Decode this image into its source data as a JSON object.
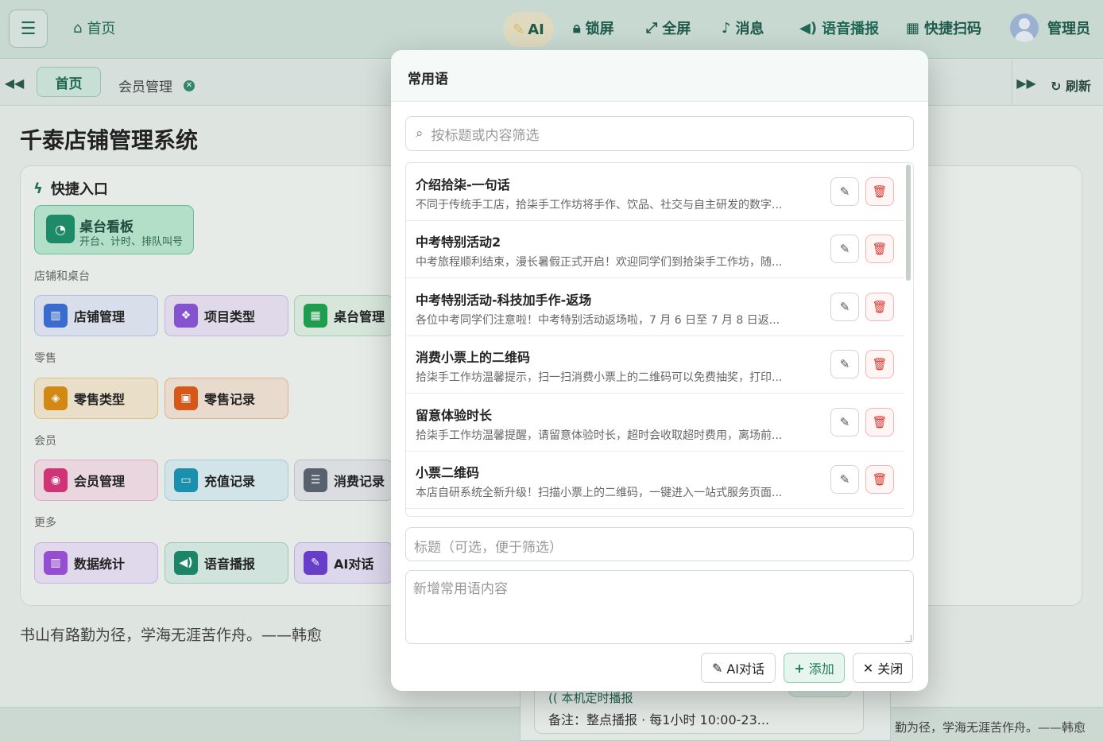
{
  "topbar": {
    "home": "首页",
    "ai": "AI",
    "lock": "锁屏",
    "fullscreen": "全屏",
    "messages": "消息",
    "voice": "语音播报",
    "scan": "快捷扫码",
    "user": "管理员"
  },
  "tabs": {
    "home": "首页",
    "member": "会员管理",
    "refresh": "刷新"
  },
  "page": {
    "title": "千泰店铺管理系统",
    "quick_entry": "快捷入口",
    "board_title": "桌台看板",
    "board_sub": "开台、计时、排队叫号",
    "sections": [
      "店铺和桌台",
      "零售",
      "会员",
      "更多"
    ],
    "tiles": {
      "shop": "店铺管理",
      "project": "项目类型",
      "table": "桌台管理",
      "retail_type": "零售类型",
      "retail_record": "零售记录",
      "member": "会员管理",
      "recharge": "充值记录",
      "consume": "消费记录",
      "stats": "数据统计",
      "voice": "语音播报",
      "ai": "AI对话"
    },
    "quote": "书山有路勤为径，学海无涯苦作舟。——韩愈",
    "footer_quote": "勤为径，学海无涯苦作舟。——韩愈",
    "broadcast_title": "本机定时播报",
    "broadcast_note": "备注：整点播报 · 每1小时 10:00-23..."
  },
  "modal": {
    "title": "常用语",
    "search_placeholder": "按标题或内容筛选",
    "items": [
      {
        "title": "介绍拾柒-一句话",
        "desc": "不同于传统手工店，拾柒手工作坊将手作、饮品、社交与自主研发的数字..."
      },
      {
        "title": "中考特别活动2",
        "desc": "中考旅程顺利结束，漫长暑假正式开启！欢迎同学们到拾柒手工作坊，随..."
      },
      {
        "title": "中考特别活动-科技加手作-返场",
        "desc": "各位中考同学们注意啦！中考特别活动返场啦，7 月 6 日至 7 月 8 日返..."
      },
      {
        "title": "消费小票上的二维码",
        "desc": "拾柒手工作坊温馨提示，扫一扫消费小票上的二维码可以免费抽奖，打印..."
      },
      {
        "title": "留意体验时长",
        "desc": "拾柒手工作坊温馨提醒，请留意体验时长，超时会收取超时费用，离场前..."
      },
      {
        "title": "小票二维码",
        "desc": "本店自研系统全新升级！扫描小票上的二维码，一键进入一站式服务页面..."
      }
    ],
    "title_placeholder": "标题（可选，便于筛选）",
    "content_placeholder": "新增常用语内容",
    "btn_ai": "AI对话",
    "btn_add": "添加",
    "btn_close": "关闭"
  },
  "colors": {
    "brand": "#1f6b55",
    "danger": "#d9342b"
  }
}
